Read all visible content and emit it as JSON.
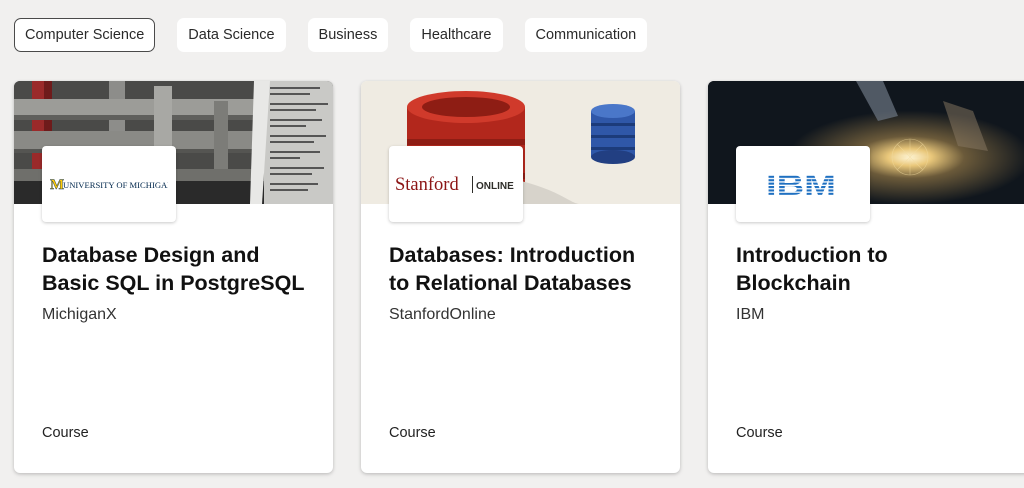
{
  "categories": [
    {
      "label": "Computer Science",
      "active": true
    },
    {
      "label": "Data Science",
      "active": false
    },
    {
      "label": "Business",
      "active": false
    },
    {
      "label": "Healthcare",
      "active": false
    },
    {
      "label": "Communication",
      "active": false
    }
  ],
  "cards": [
    {
      "title": "Database Design and Basic SQL in PostgreSQL",
      "org": "MichiganX",
      "type": "Course",
      "logo": {
        "mark": "M",
        "text": "UNIVERSITY OF MICHIGAN",
        "colors": {
          "maize": "#ffcb05",
          "blue": "#00274c"
        }
      }
    },
    {
      "title": "Databases: Introduction to Relational Databases",
      "org": "StanfordOnline",
      "type": "Course",
      "logo": {
        "text": "Stanford",
        "suffix": "ONLINE",
        "colors": {
          "cardinal": "#8c1515",
          "dark": "#2e2d29"
        }
      }
    },
    {
      "title": "Introduction to Blockchain",
      "org": "IBM",
      "type": "Course",
      "logo": {
        "text": "IBM",
        "colors": {
          "blue": "#1f70c1"
        }
      }
    }
  ]
}
